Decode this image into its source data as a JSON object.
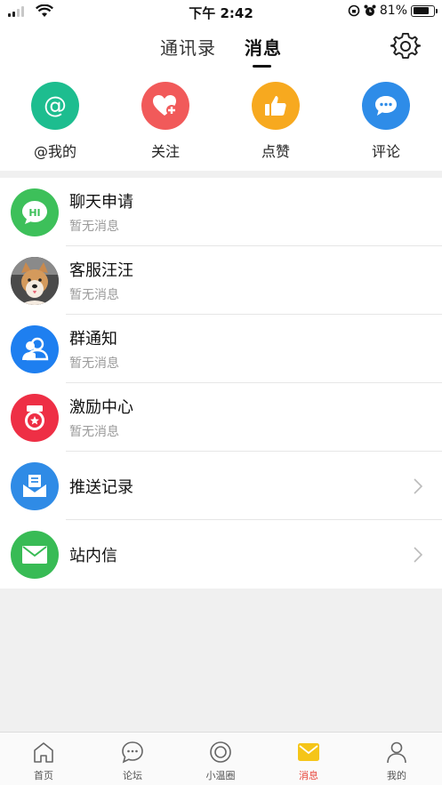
{
  "status_bar": {
    "time": "下午 2:42",
    "battery_percent": "81%"
  },
  "header": {
    "tab_contacts": "通讯录",
    "tab_messages": "消息"
  },
  "quick_actions": [
    {
      "label": "@我的",
      "icon": "at-icon",
      "color": "#1dbd8f"
    },
    {
      "label": "关注",
      "icon": "heart-plus-icon",
      "color": "#f15a5a"
    },
    {
      "label": "点赞",
      "icon": "thumbs-up-icon",
      "color": "#f7a91f"
    },
    {
      "label": "评论",
      "icon": "comment-icon",
      "color": "#2e8ce8"
    }
  ],
  "messages": [
    {
      "title": "聊天申请",
      "subtitle": "暂无消息",
      "icon": "chat-hi-icon",
      "color": "#3dc05a"
    },
    {
      "title": "客服汪汪",
      "subtitle": "暂无消息",
      "icon": "dog-avatar"
    },
    {
      "title": "群通知",
      "subtitle": "暂无消息",
      "icon": "group-icon",
      "color": "#1e7ff0"
    },
    {
      "title": "激励中心",
      "subtitle": "暂无消息",
      "icon": "reward-icon",
      "color": "#ee2f45"
    },
    {
      "title": "推送记录",
      "icon": "push-mail-icon",
      "color": "#2f8be6"
    },
    {
      "title": "站内信",
      "icon": "mail-icon",
      "color": "#38bb55"
    }
  ],
  "tabbar": [
    {
      "label": "首页",
      "icon": "home-icon"
    },
    {
      "label": "论坛",
      "icon": "forum-icon"
    },
    {
      "label": "小温圈",
      "icon": "circle-icon"
    },
    {
      "label": "消息",
      "icon": "message-icon",
      "active": true
    },
    {
      "label": "我的",
      "icon": "profile-icon"
    }
  ],
  "colors": {
    "accent": "#e8473c",
    "active_tab_icon": "#f5c518"
  }
}
